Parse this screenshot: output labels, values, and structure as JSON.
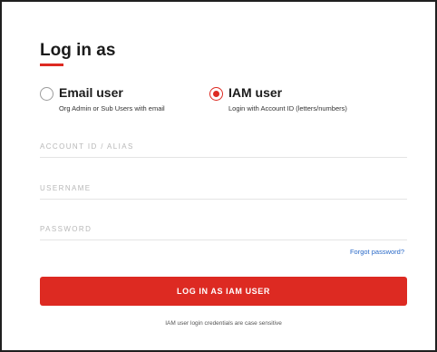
{
  "heading": "Log in as",
  "options": [
    {
      "label": "Email user",
      "sublabel": "Org Admin or Sub Users with email",
      "selected": false
    },
    {
      "label": "IAM user",
      "sublabel": "Login with Account ID (letters/numbers)",
      "selected": true
    }
  ],
  "fields": {
    "account_placeholder": "ACCOUNT ID / ALIAS",
    "username_placeholder": "USERNAME",
    "password_placeholder": "PASSWORD"
  },
  "forgot_password": "Forgot password?",
  "submit_label": "LOG IN AS IAM USER",
  "footer_note": "IAM user login credentials are case sensitive",
  "colors": {
    "accent": "#dd2a22",
    "link": "#2a6ac8"
  }
}
